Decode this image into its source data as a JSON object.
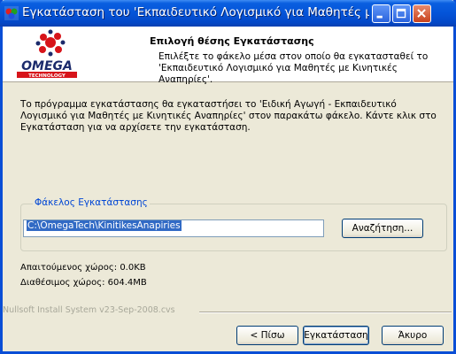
{
  "window": {
    "title": "Εγκατάσταση του 'Εκπαιδευτικό Λογισμικό για Μαθητές με Κινη..."
  },
  "header": {
    "title": "Επιλογή θέσης Εγκατάστασης",
    "subtitle": "Επιλέξτε το φάκελο μέσα στον οποίο θα εγκατασταθεί το 'Εκπαιδευτικό Λογισμικό για Μαθητές με Κινητικές Αναπηρίες'.",
    "logo_text": "OMEGA",
    "logo_subtext": "TECHNOLOGY"
  },
  "intro_text": "Το πρόγραμμα εγκατάστασης θα εγκαταστήσει το 'Ειδική Αγωγή - Εκπαιδευτικό Λογισμικό για Μαθητές με Κινητικές Αναπηρίες' στον παρακάτω φάκελο. Κάντε κλικ στο Εγκατάσταση για να αρχίσετε την εγκατάσταση.",
  "destination": {
    "label": "Φάκελος Εγκατάστασης",
    "path": "C:\\OmegaTech\\KinitikesAnapiries",
    "browse_label": "Αναζήτηση..."
  },
  "space": {
    "required": "Απαιτούμενος χώρος: 0.0KB",
    "available": "Διαθέσιμος χώρος: 604.4MB"
  },
  "branding": "Nullsoft Install System v23-Sep-2008.cvs",
  "buttons": {
    "back": "< Πίσω",
    "install": "Εγκατάσταση",
    "cancel": "Άκυρο"
  },
  "colors": {
    "titlebar": "#0454d8",
    "group_label": "#0046d5",
    "selection": "#316ac5",
    "logo_red": "#d7141a",
    "logo_navy": "#1b2a6b"
  },
  "icons": {
    "title_icon": "installer-icon",
    "minimize": "minimize-icon",
    "maximize": "maximize-icon",
    "close": "close-icon",
    "logo": "omega-logo"
  }
}
